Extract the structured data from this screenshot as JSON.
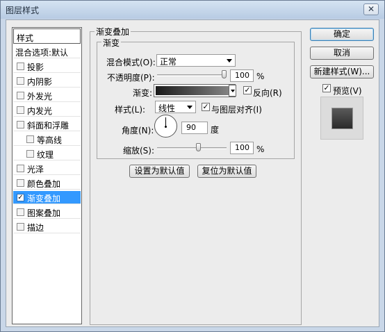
{
  "window": {
    "title": "图层样式",
    "close_glyph": "✕"
  },
  "style_list": {
    "header": "样式",
    "items": [
      {
        "label": "混合选项:默认",
        "checkbox": false,
        "checked": false,
        "selected": false,
        "indent": 0
      },
      {
        "label": "投影",
        "checkbox": true,
        "checked": false,
        "selected": false,
        "indent": 0
      },
      {
        "label": "内阴影",
        "checkbox": true,
        "checked": false,
        "selected": false,
        "indent": 0
      },
      {
        "label": "外发光",
        "checkbox": true,
        "checked": false,
        "selected": false,
        "indent": 0
      },
      {
        "label": "内发光",
        "checkbox": true,
        "checked": false,
        "selected": false,
        "indent": 0
      },
      {
        "label": "斜面和浮雕",
        "checkbox": true,
        "checked": false,
        "selected": false,
        "indent": 0
      },
      {
        "label": "等高线",
        "checkbox": true,
        "checked": false,
        "selected": false,
        "indent": 1
      },
      {
        "label": "纹理",
        "checkbox": true,
        "checked": false,
        "selected": false,
        "indent": 1
      },
      {
        "label": "光泽",
        "checkbox": true,
        "checked": false,
        "selected": false,
        "indent": 0
      },
      {
        "label": "颜色叠加",
        "checkbox": true,
        "checked": false,
        "selected": false,
        "indent": 0
      },
      {
        "label": "渐变叠加",
        "checkbox": true,
        "checked": true,
        "selected": true,
        "indent": 0
      },
      {
        "label": "图案叠加",
        "checkbox": true,
        "checked": false,
        "selected": false,
        "indent": 0
      },
      {
        "label": "描边",
        "checkbox": true,
        "checked": false,
        "selected": false,
        "indent": 0
      }
    ]
  },
  "gradient_overlay": {
    "group_title": "渐变叠加",
    "subgroup_title": "渐变",
    "blend_mode_label": "混合模式(O):",
    "blend_mode_value": "正常",
    "opacity_label": "不透明度(P):",
    "opacity_value": "100",
    "opacity_unit": "%",
    "opacity_fraction": 1.0,
    "gradient_label": "渐变:",
    "reverse_label": "反向(R)",
    "reverse_checked": true,
    "style_label": "样式(L):",
    "style_value": "线性",
    "align_label": "与图层对齐(I)",
    "align_checked": true,
    "angle_label": "角度(N):",
    "angle_value": "90",
    "angle_unit": "度",
    "scale_label": "缩放(S):",
    "scale_value": "100",
    "scale_unit": "%",
    "scale_fraction": 0.6,
    "set_default_label": "设置为默认值",
    "reset_default_label": "复位为默认值"
  },
  "actions": {
    "ok_label": "确定",
    "cancel_label": "取消",
    "new_style_label": "新建样式(W)...",
    "preview_label": "预览(V)",
    "preview_checked": true
  },
  "check_glyph": "✓",
  "colors": {
    "selection": "#3399ff",
    "title_gradient_top": "#d5e3f2"
  }
}
